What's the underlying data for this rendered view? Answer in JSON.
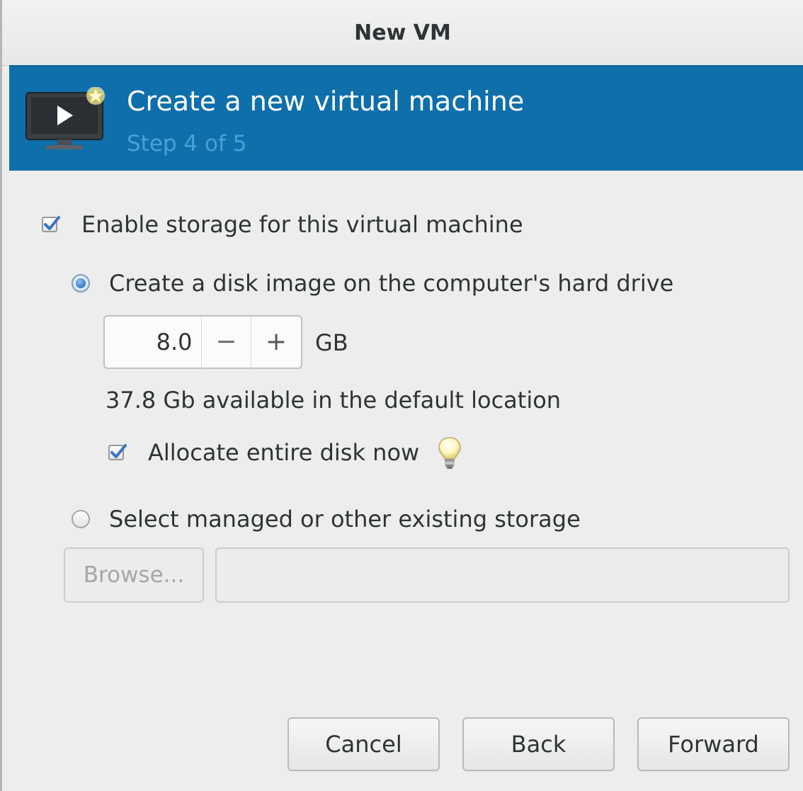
{
  "window": {
    "title": "New VM"
  },
  "header": {
    "icon": "vm-display-new-icon",
    "title": "Create a new virtual machine",
    "step": "Step 4 of 5",
    "accent_color": "#0e6fab"
  },
  "storage": {
    "enable_label": "Enable storage for this virtual machine",
    "enable_checked": true,
    "create_disk": {
      "label": "Create a disk image on the computer's hard drive",
      "selected": true,
      "size_value": "8.0",
      "size_unit": "GB",
      "decrement_symbol": "−",
      "increment_symbol": "+",
      "available_text": "37.8 Gb available in the default location",
      "allocate_label": "Allocate entire disk now",
      "allocate_checked": true,
      "hint_icon": "lightbulb-icon"
    },
    "existing": {
      "label": "Select managed or other existing storage",
      "selected": false,
      "browse_label": "Browse...",
      "path_value": ""
    }
  },
  "footer": {
    "cancel_label": "Cancel",
    "back_label": "Back",
    "forward_label": "Forward"
  }
}
